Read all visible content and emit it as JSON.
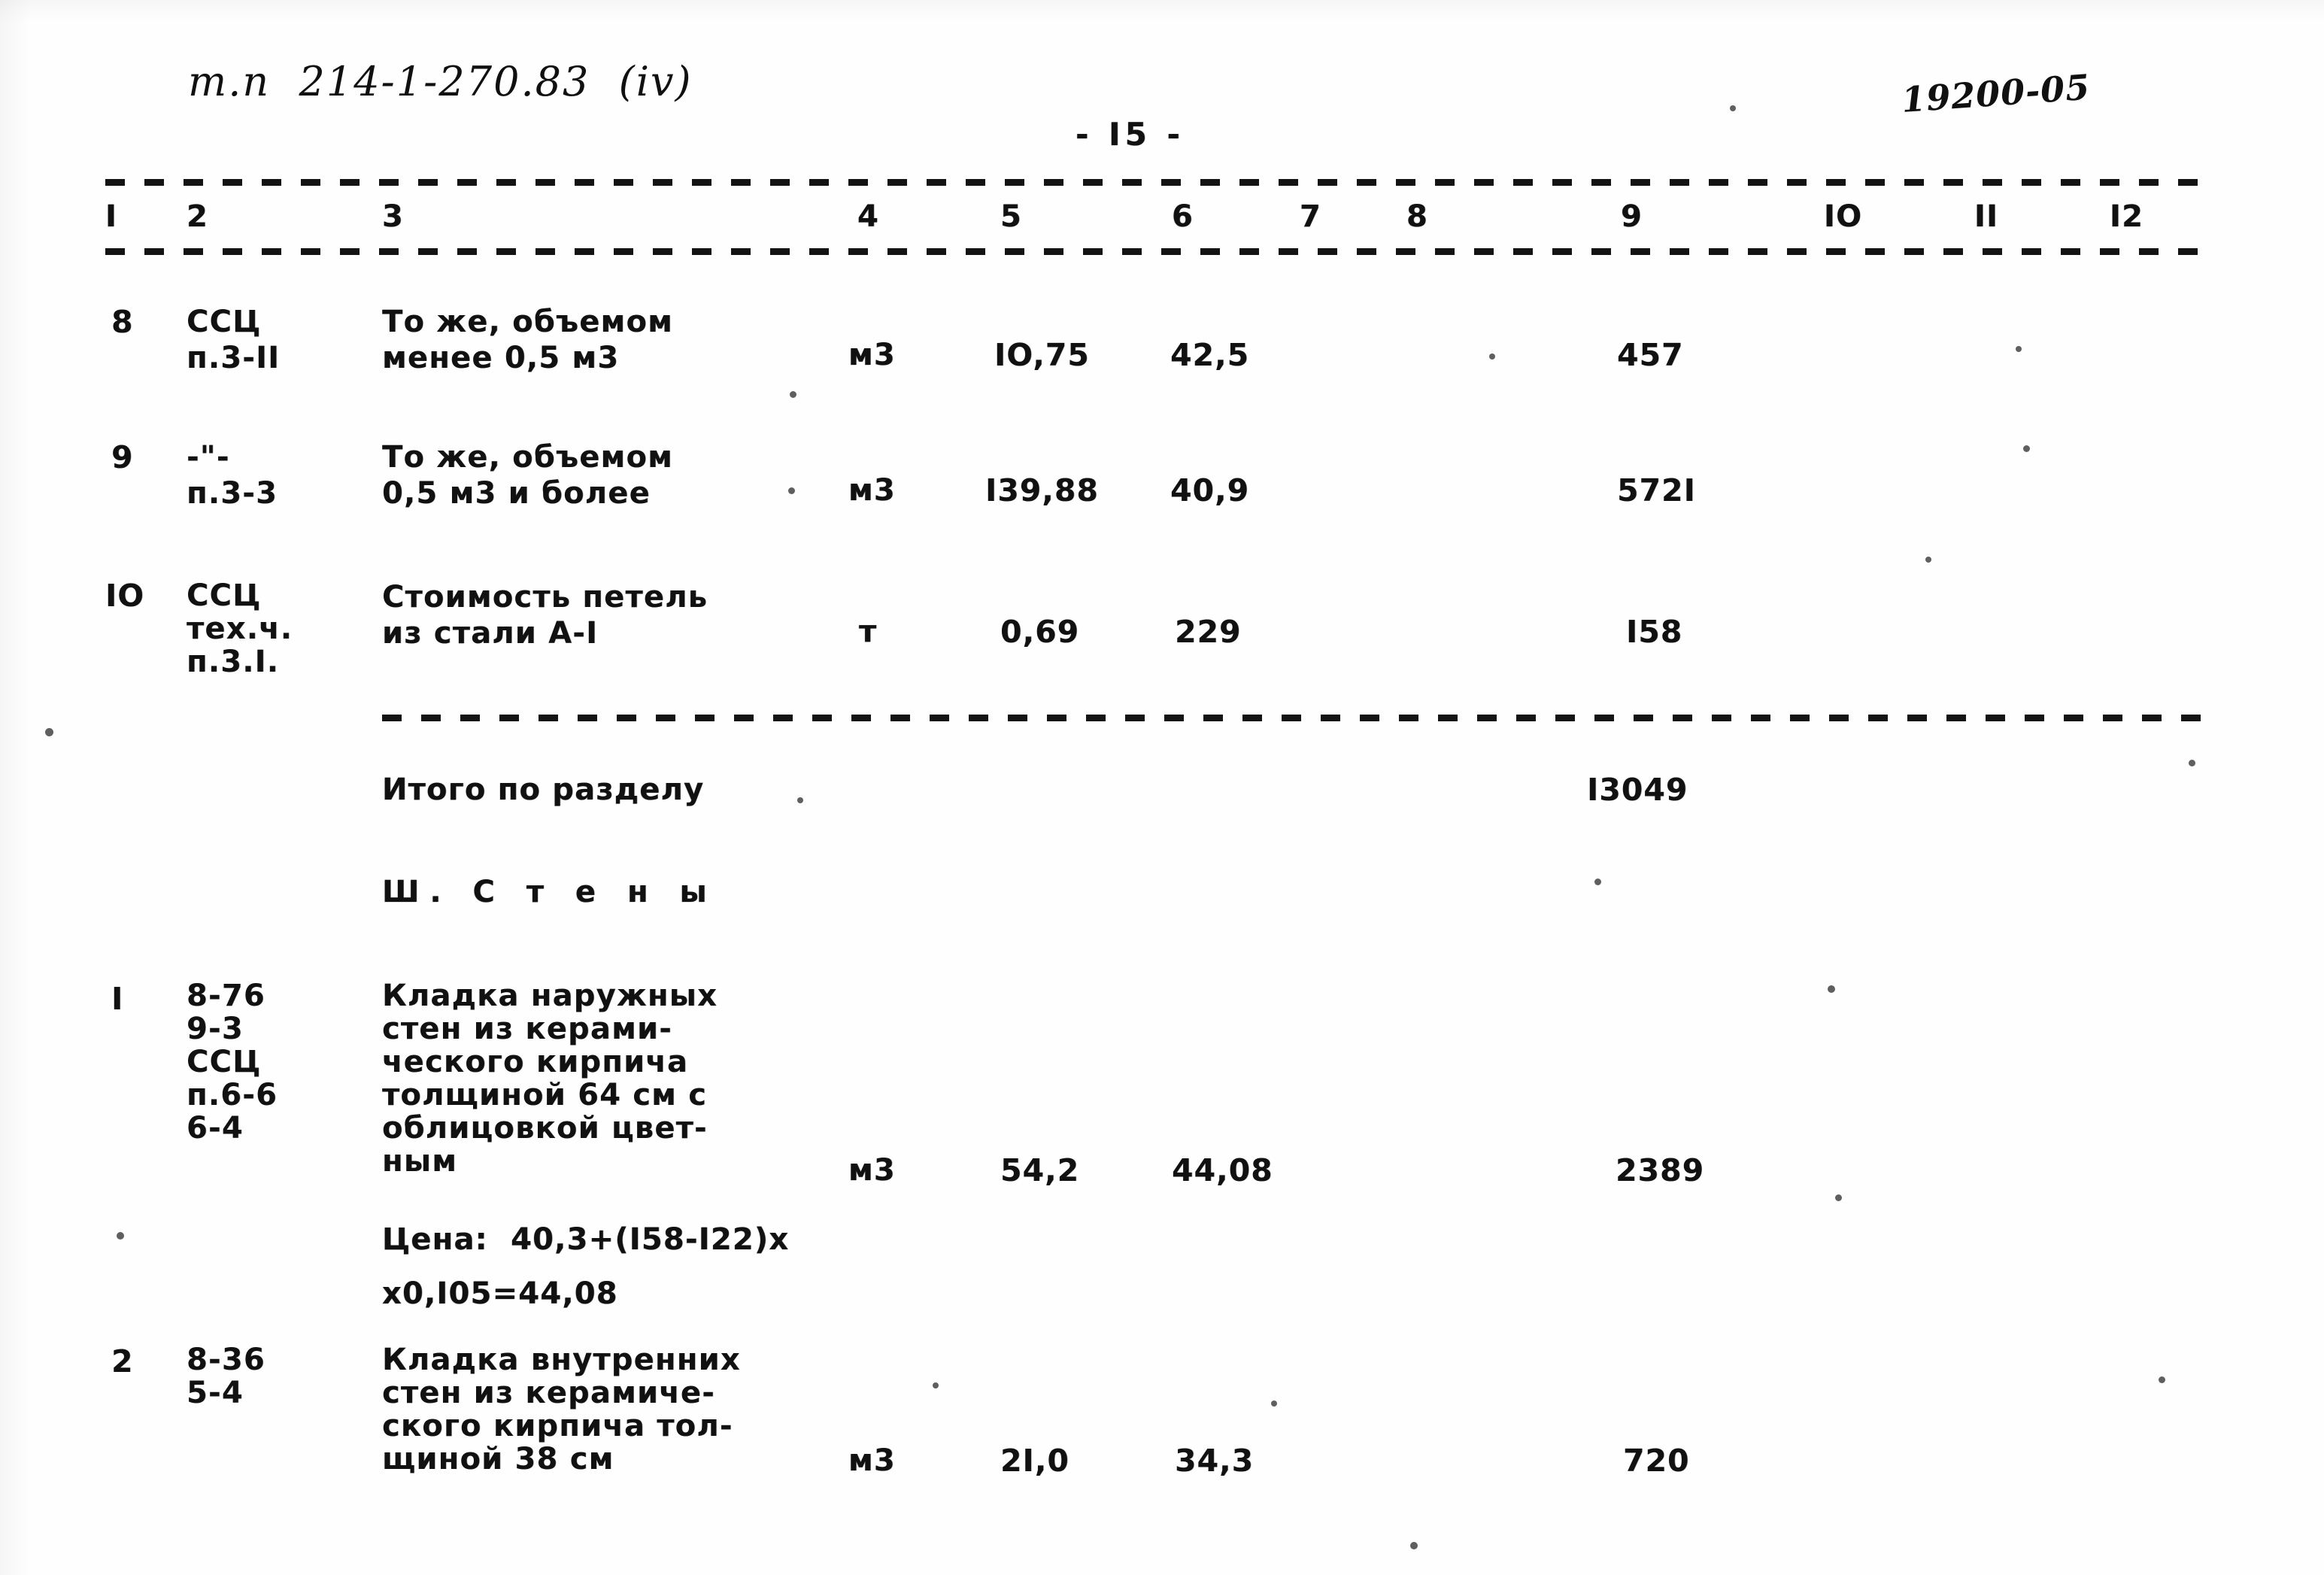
{
  "document": {
    "project_code": "т.п  214-1-270.83  (iv)",
    "stamp_number": "19200-05",
    "page_label": "- I5 -"
  },
  "table": {
    "column_headers": [
      "I",
      "2",
      "3",
      "4",
      "5",
      "6",
      "7",
      "8",
      "9",
      "IO",
      "II",
      "I2"
    ],
    "rows": [
      {
        "no": "8",
        "code": "ССЦ\nп.3-II",
        "description": "То же, объемом\nменее 0,5 м3",
        "unit": "м3",
        "qty": "IO,75",
        "price": "42,5",
        "col7": "",
        "col8": "",
        "total": "457",
        "col10": "",
        "col11": "",
        "col12": ""
      },
      {
        "no": "9",
        "code": "-\"-\nп.3-3",
        "description": "То же, объемом\n0,5 м3 и более",
        "unit": "м3",
        "qty": "I39,88",
        "price": "40,9",
        "col7": "",
        "col8": "",
        "total": "572I",
        "col10": "",
        "col11": "",
        "col12": ""
      },
      {
        "no": "IO",
        "code": "ССЦ\nтех.ч.\nп.3.I.",
        "description": "Стоимость петель\nиз стали А-I",
        "unit": "т",
        "qty": "0,69",
        "price": "229",
        "col7": "",
        "col8": "",
        "total": "I58",
        "col10": "",
        "col11": "",
        "col12": ""
      }
    ],
    "subtotal": {
      "label": "Итого по разделу",
      "value": "I3049"
    },
    "section": {
      "title": "Ш. С т е н ы"
    },
    "section_rows": [
      {
        "no": "I",
        "code": "8-76\n9-3\nССЦ\nп.6-6\n6-4",
        "description": "Кладка наружных\nстен из керами-\nческого кирпича\nтолщиной 64 см с\nоблицовкой цвет-\nным",
        "unit": "м3",
        "qty": "54,2",
        "price": "44,08",
        "col7": "",
        "col8": "",
        "total": "2389",
        "note_line1": "Цена:  40,3+(I58-I22)х",
        "note_line2": "х0,I05=44,08"
      },
      {
        "no": "2",
        "code": "8-36\n5-4",
        "description": "Кладка внутренних\nстен из керамиче-\nского кирпича тол-\nщиной 38 см",
        "unit": "м3",
        "qty": "2I,0",
        "price": "34,3",
        "col7": "",
        "col8": "",
        "total": "720",
        "note_line1": "",
        "note_line2": ""
      }
    ]
  }
}
